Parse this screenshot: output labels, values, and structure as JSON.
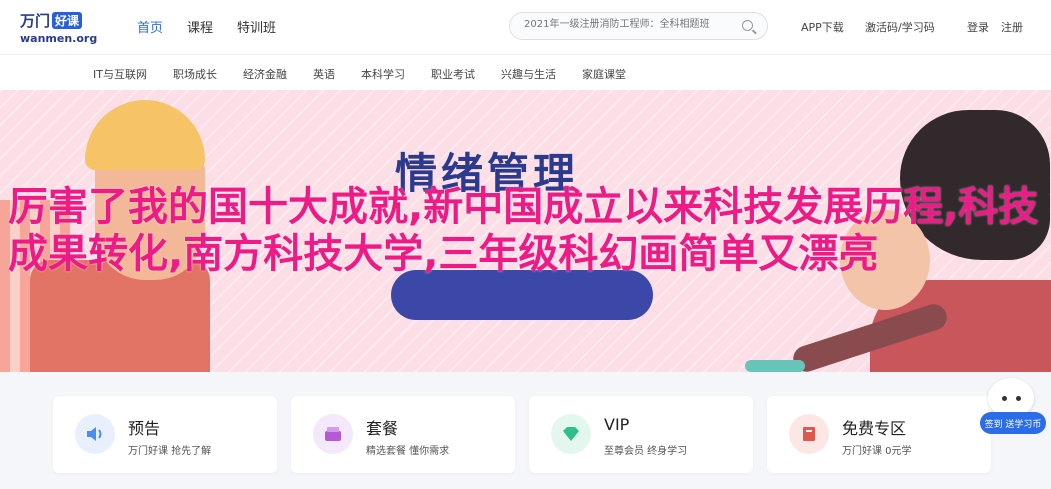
{
  "header": {
    "logo_text": "万门",
    "logo_badge": "好课",
    "logo_sub": "wanmen.org",
    "nav": [
      "首页",
      "课程",
      "特训班"
    ],
    "search_placeholder": "2021年一级注册消防工程师：全科相题班",
    "links": [
      "APP下载",
      "激活码/学习码",
      "登录",
      "注册"
    ]
  },
  "subnav": [
    "IT与互联网",
    "职场成长",
    "经济金融",
    "英语",
    "本科学习",
    "职业考试",
    "兴趣与生活",
    "家庭课堂"
  ],
  "banner": {
    "board_title": "情绪管理",
    "overlay_title": "厉害了我的国十大成就,新中国成立以来科技发展历程,科技成果转化,南方科技大学,三年级科幻画简单又漂亮"
  },
  "cards": [
    {
      "title": "预告",
      "sub": "万门好课 抢先了解",
      "icon": "speaker-icon",
      "color": "#4a8df0",
      "bg": "#e8f0fd"
    },
    {
      "title": "套餐",
      "sub": "精选套餐 懂你需求",
      "icon": "package-icon",
      "color": "#b45ad6",
      "bg": "#f4e8fb"
    },
    {
      "title": "VIP",
      "sub": "至尊会员 终身学习",
      "icon": "diamond-icon",
      "color": "#2fbf8c",
      "bg": "#e3f7ef"
    },
    {
      "title": "免费专区",
      "sub": "万门好课 0元学",
      "icon": "book-icon",
      "color": "#e0574e",
      "bg": "#fde7e5"
    }
  ],
  "mascot": {
    "badge": "签到 送学习币"
  }
}
